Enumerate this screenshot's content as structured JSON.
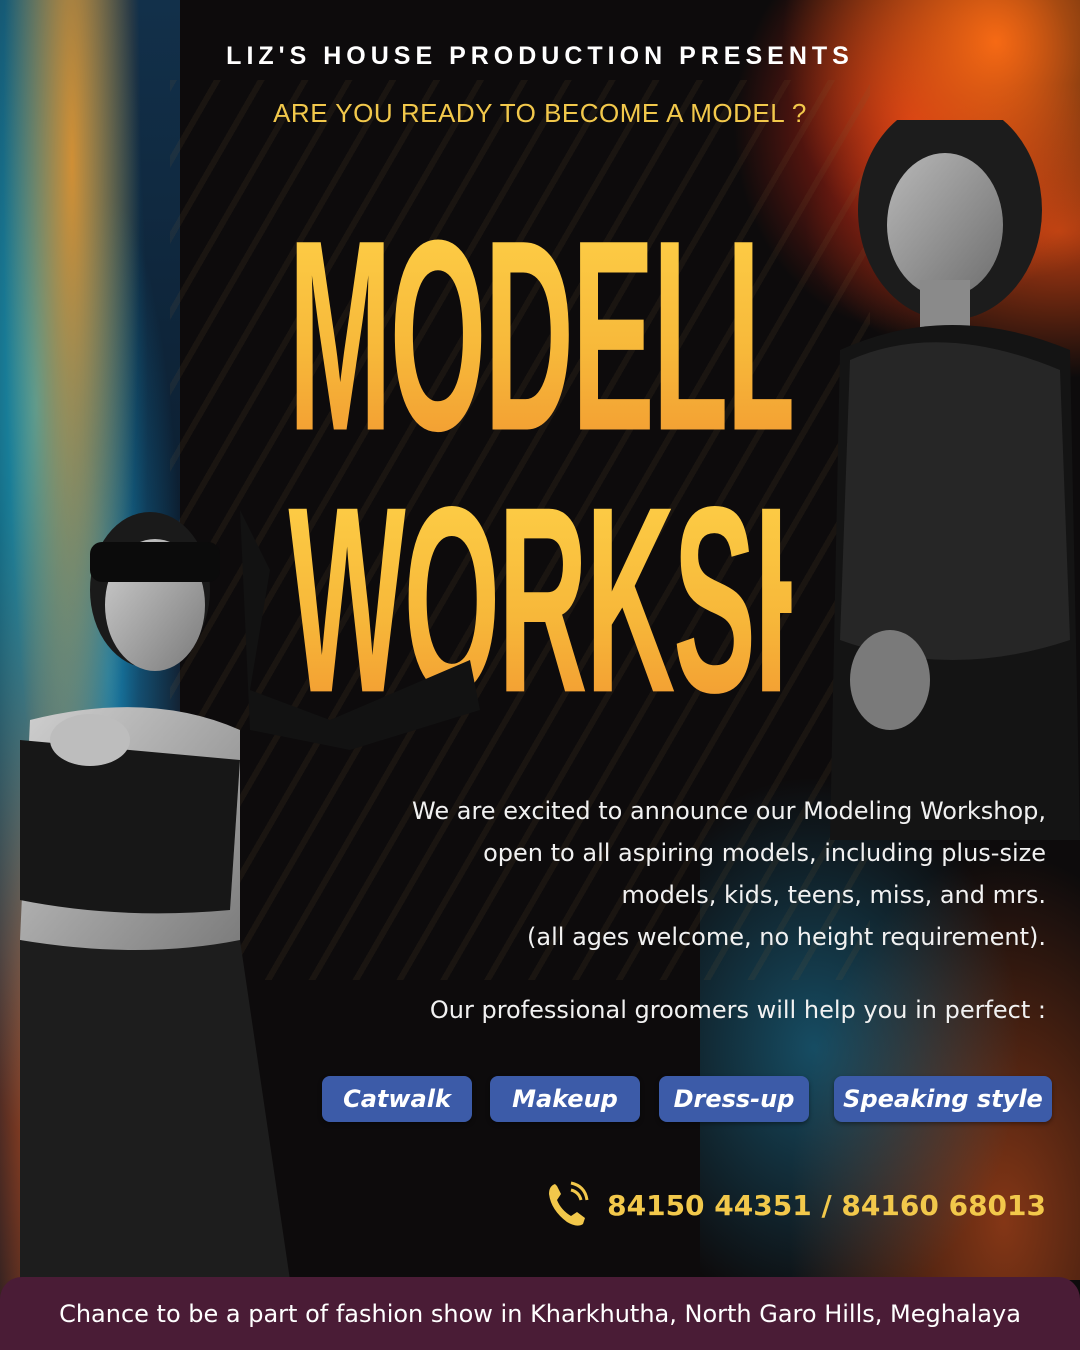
{
  "header": {
    "presents": "LIZ'S HOUSE PRODUCTION PRESENTS",
    "question": "ARE YOU READY TO BECOME A MODEL ?"
  },
  "title": {
    "line1": "MODELLING",
    "line2": "WORKSHOP"
  },
  "body": {
    "lines": [
      "We are excited to announce our Modeling Workshop,",
      "open to all aspiring models, including plus-size",
      "models, kids, teens, miss, and mrs.",
      "(all ages welcome, no height requirement)."
    ],
    "groomers": "Our professional groomers will help you in perfect :"
  },
  "skills": [
    "Catwalk",
    "Makeup",
    "Dress-up",
    "Speaking style"
  ],
  "contact": {
    "icon": "phone-icon",
    "phones": "84150 44351 /  84160 68013"
  },
  "footer": {
    "text": "Chance to be a part of fashion show in Kharkhutha, North Garo Hills, Meghalaya"
  },
  "colors": {
    "accent_gold": "#f2c84b",
    "pill_blue": "#3c5ba8",
    "footer_plum": "#4a1c36",
    "background": "#0d0b0c"
  }
}
